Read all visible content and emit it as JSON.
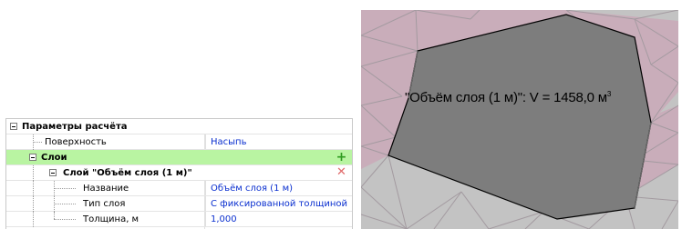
{
  "grid": {
    "category_title": "Параметры расчёта",
    "surface_label": "Поверхность",
    "surface_value": "Насыпь",
    "layers_label": "Слои",
    "add_glyph": "+",
    "layer_title": "Слой \"Объём слоя (1 м)\"",
    "delete_glyph": "✕",
    "props": [
      {
        "label": "Название",
        "value": "Объём слоя (1 м)"
      },
      {
        "label": "Тип слоя",
        "value": "С фиксированной толщиной"
      },
      {
        "label": "Толщина, м",
        "value": "1,000"
      }
    ]
  },
  "view": {
    "label_text": "\"Объём слоя (1 м)\": V = 1458,0 м",
    "label_unit_sup": "3",
    "colors": {
      "background": "#bcbcbc",
      "pink_surface": "#c9adba",
      "gray_surface": "#c3c3c3",
      "layer_fill": "#7d7d7d"
    }
  }
}
